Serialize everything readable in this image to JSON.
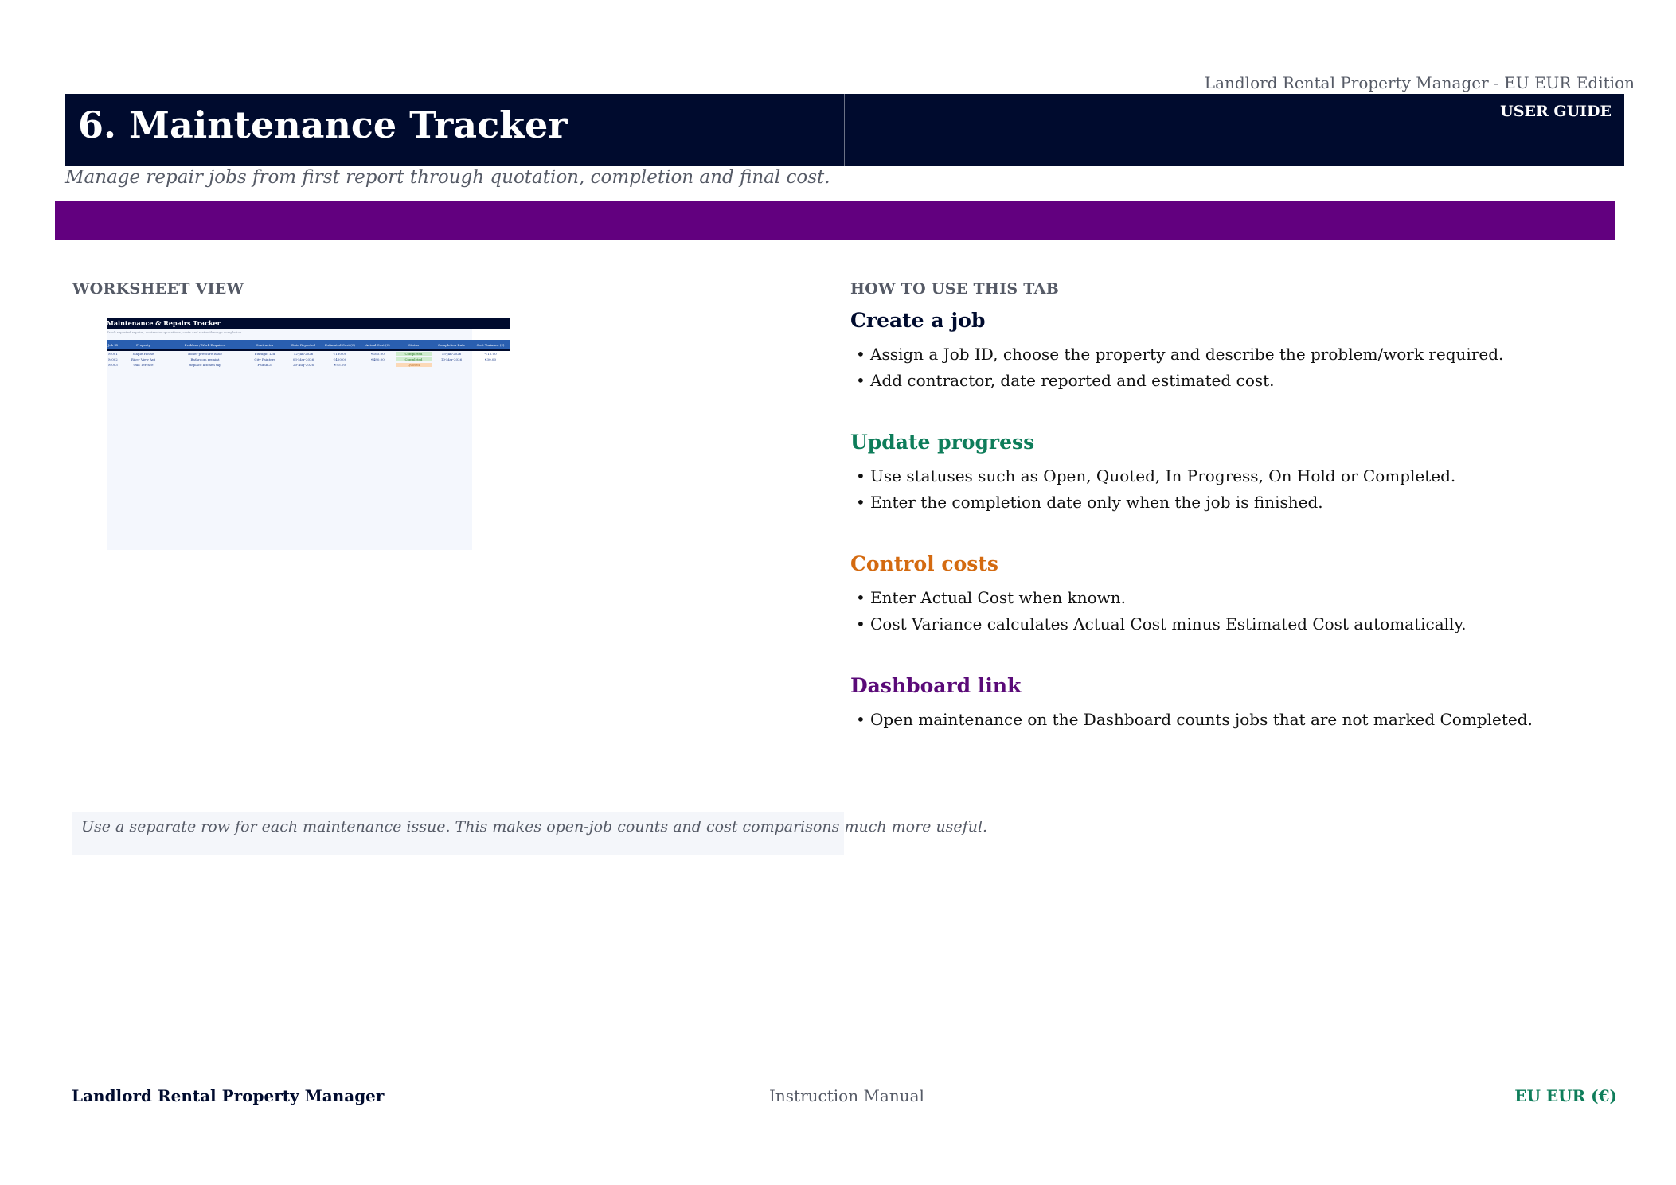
{
  "header": {
    "edition": "Landlord Rental Property Manager - EU EUR Edition",
    "title": "6. Maintenance Tracker",
    "guide_label": "USER GUIDE",
    "subtitle": "Manage repair jobs from first report through quotation, completion and final cost."
  },
  "colors": {
    "navy": "#000b2e",
    "purple_bar": "#62007f",
    "green": "#0e7d5a",
    "orange": "#d46a10",
    "purple_text": "#5a0a78"
  },
  "worksheet": {
    "label": "WORKSHEET VIEW",
    "thumb_title": "Maintenance & Repairs Tracker",
    "thumb_subtitle": "Track reported repairs, contractor quotations, costs and status through completion.",
    "columns": [
      "Job ID",
      "Property",
      "Problem / Work Required",
      "Contractor",
      "Date Reported",
      "Estimated Cost (€)",
      "Actual Cost (€)",
      "Status",
      "Completion Date",
      "Cost Variance (€)"
    ],
    "rows": [
      [
        "M001",
        "Maple House",
        "Boiler pressure issue",
        "FixRight Ltd",
        "12-Jan-2026",
        "€180.00",
        "€165.00",
        "Completed",
        "15-Jan-2026",
        "-€15.00"
      ],
      [
        "M002",
        "River View Apt",
        "Bathroom repaint",
        "City Painters",
        "03-Mar-2026",
        "€450.00",
        "€480.00",
        "Completed",
        "10-Mar-2026",
        "€30.00"
      ],
      [
        "M003",
        "Oak Terrace",
        "Replace kitchen tap",
        "PlumbCo",
        "20-Aug-2026",
        "€95.00",
        "",
        "Quoted",
        "",
        ""
      ]
    ]
  },
  "how_to": {
    "label": "HOW TO USE THIS TAB",
    "sections": [
      {
        "title": "Create a job",
        "bullets": [
          "Assign a Job ID, choose the property and describe the problem/work required.",
          "Add contractor, date reported and estimated cost."
        ]
      },
      {
        "title": "Update progress",
        "bullets": [
          "Use statuses such as Open, Quoted, In Progress, On Hold or Completed.",
          "Enter the completion date only when the job is finished."
        ]
      },
      {
        "title": "Control costs",
        "bullets": [
          "Enter Actual Cost when known.",
          "Cost Variance calculates Actual Cost minus Estimated Cost automatically."
        ]
      },
      {
        "title": "Dashboard link",
        "bullets": [
          "Open maintenance on the Dashboard counts jobs that are not marked Completed."
        ]
      }
    ]
  },
  "tip": "Use a separate row for each maintenance issue. This makes open-job counts and cost comparisons much more useful.",
  "footer": {
    "left": "Landlord Rental Property Manager",
    "center": "Instruction Manual",
    "right": "EU EUR (€)"
  }
}
